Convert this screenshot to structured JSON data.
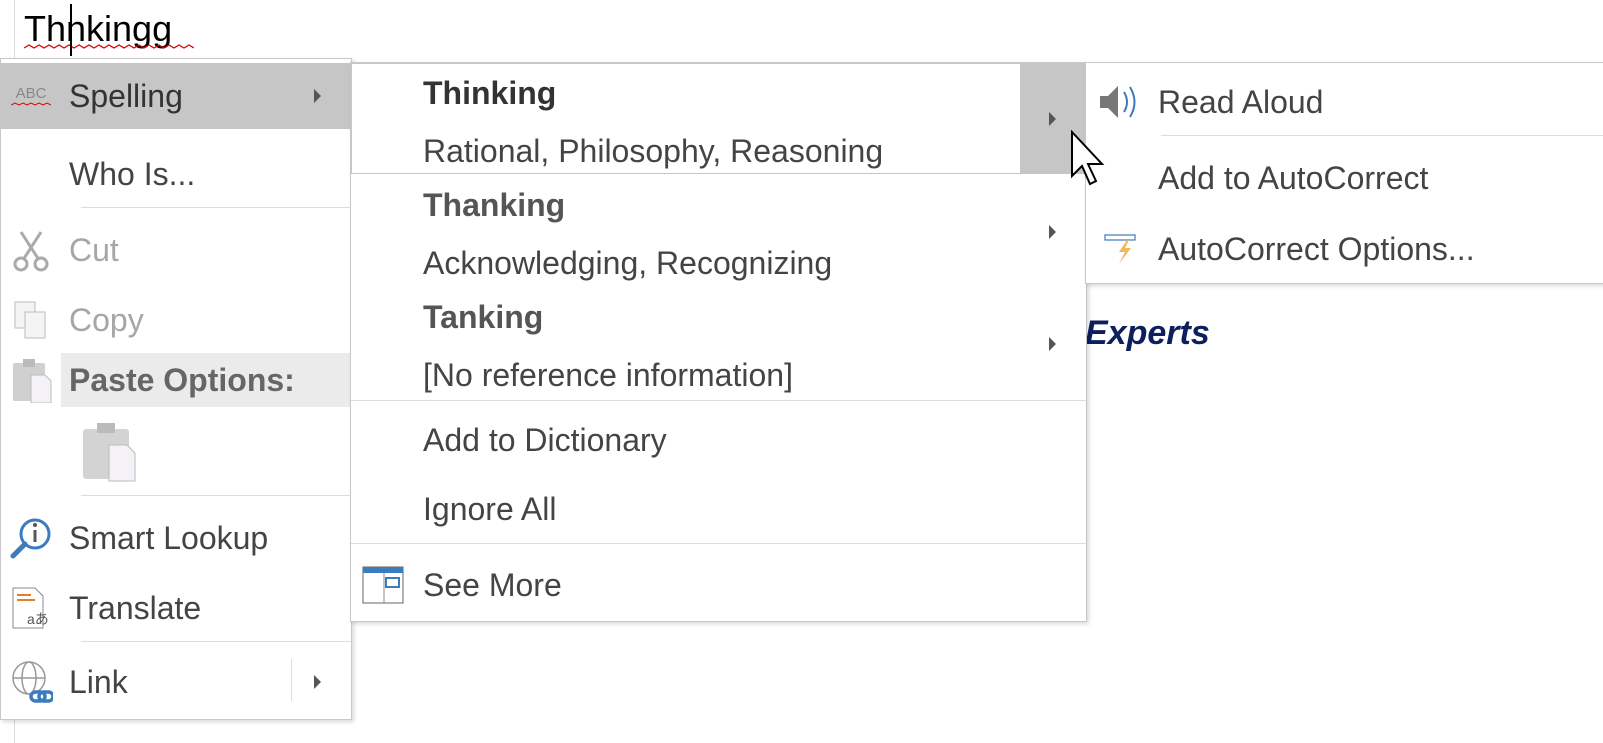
{
  "document": {
    "word": "Thnkingg",
    "visible_text": "Experts"
  },
  "context_menu": {
    "items": [
      {
        "label": "Spelling",
        "icon": "abc-spelling-icon",
        "submenu": true,
        "highlighted": true
      },
      {
        "label": "Who Is..."
      },
      {
        "label": "Cut",
        "icon": "scissors-icon",
        "disabled": true
      },
      {
        "label": "Copy",
        "icon": "copy-icon",
        "disabled": true
      },
      {
        "label": "Paste Options:",
        "icon": "clipboard-icon"
      },
      {
        "label": "Smart Lookup",
        "icon": "smart-lookup-icon"
      },
      {
        "label": "Translate",
        "icon": "translate-icon"
      },
      {
        "label": "Link",
        "icon": "globe-link-icon",
        "submenu": true
      }
    ]
  },
  "spelling_menu": {
    "suggestions": [
      {
        "word": "Thinking",
        "synonyms": "Rational, Philosophy, Reasoning",
        "highlighted": true
      },
      {
        "word": "Thanking",
        "synonyms": "Acknowledging, Recognizing"
      },
      {
        "word": "Tanking",
        "synonyms": "[No reference information]"
      }
    ],
    "add_to_dictionary": "Add to Dictionary",
    "ignore_all": "Ignore All",
    "see_more": "See More"
  },
  "suggestion_submenu": {
    "read_aloud": "Read Aloud",
    "add_to_autocorrect": "Add to AutoCorrect",
    "autocorrect_options": "AutoCorrect Options..."
  },
  "colors": {
    "highlight": "#c6c6c6",
    "paste_header_bg": "#ebebeb",
    "squiggle": "#e00000",
    "experts_text": "#0d1f5c",
    "icon_blue": "#3c7bbf"
  }
}
